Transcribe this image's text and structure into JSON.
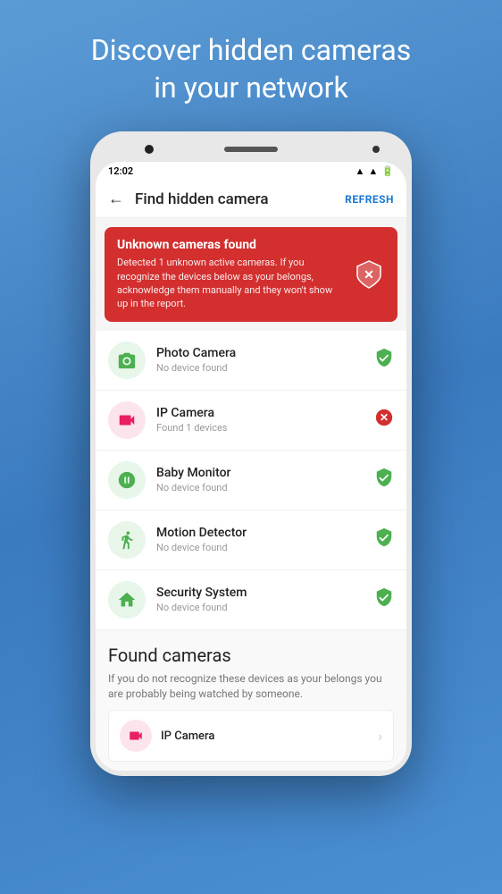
{
  "hero": {
    "title": "Discover hidden cameras\nin your network"
  },
  "status_bar": {
    "time": "12:02",
    "wifi": "▲",
    "signal": "▲▲▲",
    "battery": "▮"
  },
  "header": {
    "back_label": "←",
    "title": "Find hidden camera",
    "refresh_label": "REFRESH"
  },
  "alert": {
    "title": "Unknown cameras found",
    "description": "Detected 1 unknown active cameras. If you recognize the devices below as your belongs, acknowledge them manually and they won't show up in the report.",
    "shield_icon": "✕"
  },
  "devices": [
    {
      "name": "Photo Camera",
      "status": "No device found",
      "icon": "📷",
      "icon_style": "green",
      "status_type": "ok"
    },
    {
      "name": "IP Camera",
      "status": "Found 1 devices",
      "icon": "📹",
      "icon_style": "pink",
      "status_type": "error"
    },
    {
      "name": "Baby Monitor",
      "status": "No device found",
      "icon": "📡",
      "icon_style": "green",
      "status_type": "ok"
    },
    {
      "name": "Motion Detector",
      "status": "No device found",
      "icon": "🏃",
      "icon_style": "green",
      "status_type": "ok"
    },
    {
      "name": "Security System",
      "status": "No device found",
      "icon": "🏠",
      "icon_style": "green",
      "status_type": "ok"
    }
  ],
  "found_cameras": {
    "title": "Found cameras",
    "description": "If you do not recognize these devices as your belongs you are probably being watched by someone.",
    "items": [
      {
        "name": "IP Camera",
        "icon": "📹"
      }
    ]
  }
}
